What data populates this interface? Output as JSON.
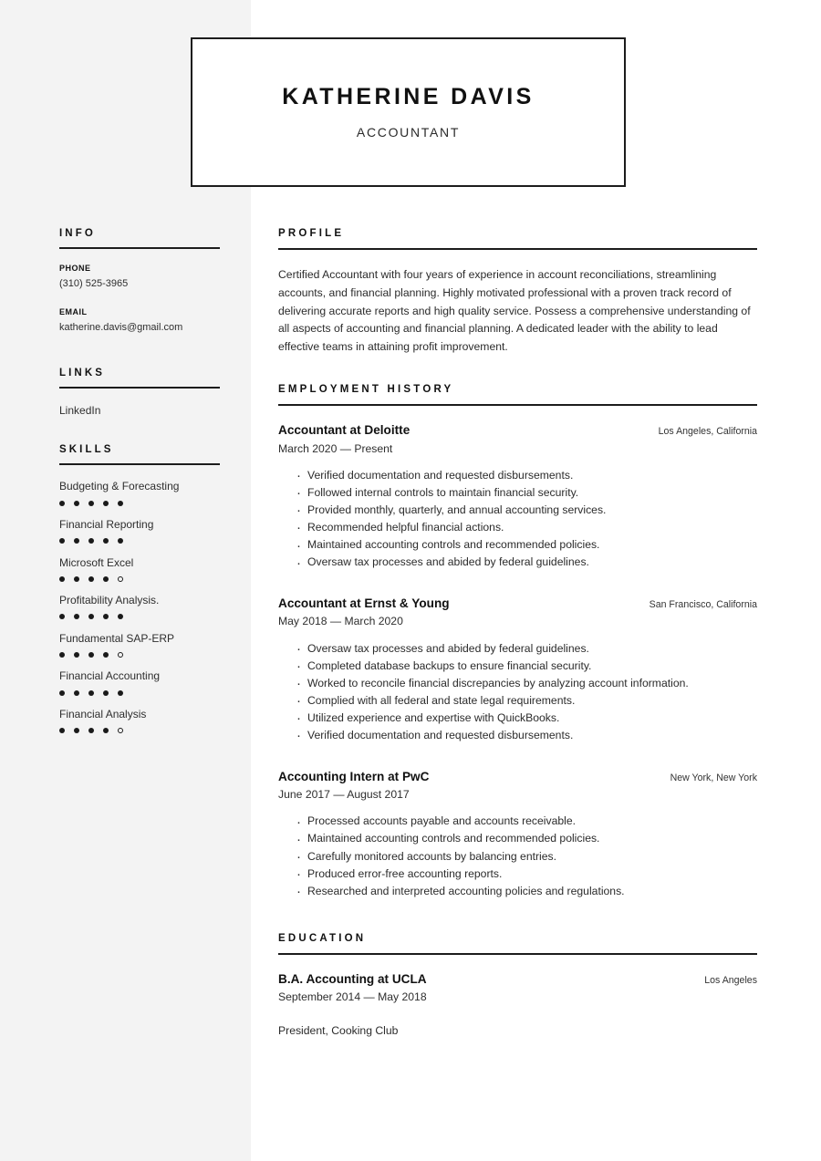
{
  "header": {
    "full_name": "KATHERINE DAVIS",
    "job_title": "ACCOUNTANT"
  },
  "sidebar": {
    "info": {
      "section_title": "INFO",
      "items": [
        {
          "label": "PHONE",
          "value": "(310) 525-3965"
        },
        {
          "label": "EMAIL",
          "value": "katherine.davis@gmail.com"
        }
      ]
    },
    "links": {
      "section_title": "LINKS",
      "items": [
        {
          "label": "LinkedIn"
        }
      ]
    },
    "skills": {
      "section_title": "SKILLS",
      "max_rating": 5,
      "items": [
        {
          "name": "Budgeting & Forecasting",
          "rating": 5
        },
        {
          "name": "Financial Reporting",
          "rating": 5
        },
        {
          "name": "Microsoft Excel",
          "rating": 4
        },
        {
          "name": "Profitability Analysis.",
          "rating": 5
        },
        {
          "name": "Fundamental SAP-ERP",
          "rating": 4
        },
        {
          "name": "Financial Accounting",
          "rating": 5
        },
        {
          "name": "Financial Analysis",
          "rating": 4
        }
      ]
    }
  },
  "main": {
    "profile": {
      "section_title": "PROFILE",
      "text": "Certified Accountant with four years of experience in account reconciliations, streamlining accounts, and financial planning. Highly motivated professional with a proven track record of delivering accurate reports and high quality service. Possess a comprehensive understanding of all aspects of accounting and financial planning. A dedicated leader with the ability to lead effective teams in attaining profit improvement."
    },
    "employment": {
      "section_title": "EMPLOYMENT HISTORY",
      "entries": [
        {
          "title": "Accountant at Deloitte",
          "location": "Los Angeles, California",
          "date": "March 2020 — Present",
          "bullets": [
            "Verified documentation and requested disbursements.",
            "Followed internal controls to maintain financial security.",
            "Provided monthly, quarterly, and annual accounting services.",
            "Recommended helpful financial actions.",
            "Maintained accounting controls and recommended policies.",
            "Oversaw tax processes and abided by federal guidelines."
          ]
        },
        {
          "title": "Accountant at Ernst & Young",
          "location": "San Francisco, California",
          "date": "May 2018 — March 2020",
          "bullets": [
            "Oversaw tax processes and abided by federal guidelines.",
            "Completed database backups to ensure financial security.",
            "Worked to reconcile financial discrepancies by analyzing account information.",
            "Complied with all federal and state legal requirements.",
            "Utilized experience and expertise with QuickBooks.",
            "Verified documentation and requested disbursements."
          ]
        },
        {
          "title": "Accounting Intern at PwC",
          "location": "New York, New York",
          "date": "June 2017 — August 2017",
          "bullets": [
            "Processed accounts payable and accounts receivable.",
            "Maintained accounting controls and recommended policies.",
            "Carefully monitored accounts by balancing entries.",
            "Produced error-free accounting reports.",
            "Researched and interpreted accounting policies and regulations."
          ]
        }
      ]
    },
    "education": {
      "section_title": "EDUCATION",
      "entries": [
        {
          "title": "B.A. Accounting at UCLA",
          "location": "Los Angeles",
          "date": "September 2014 — May 2018",
          "note": "President, Cooking Club"
        }
      ]
    }
  }
}
